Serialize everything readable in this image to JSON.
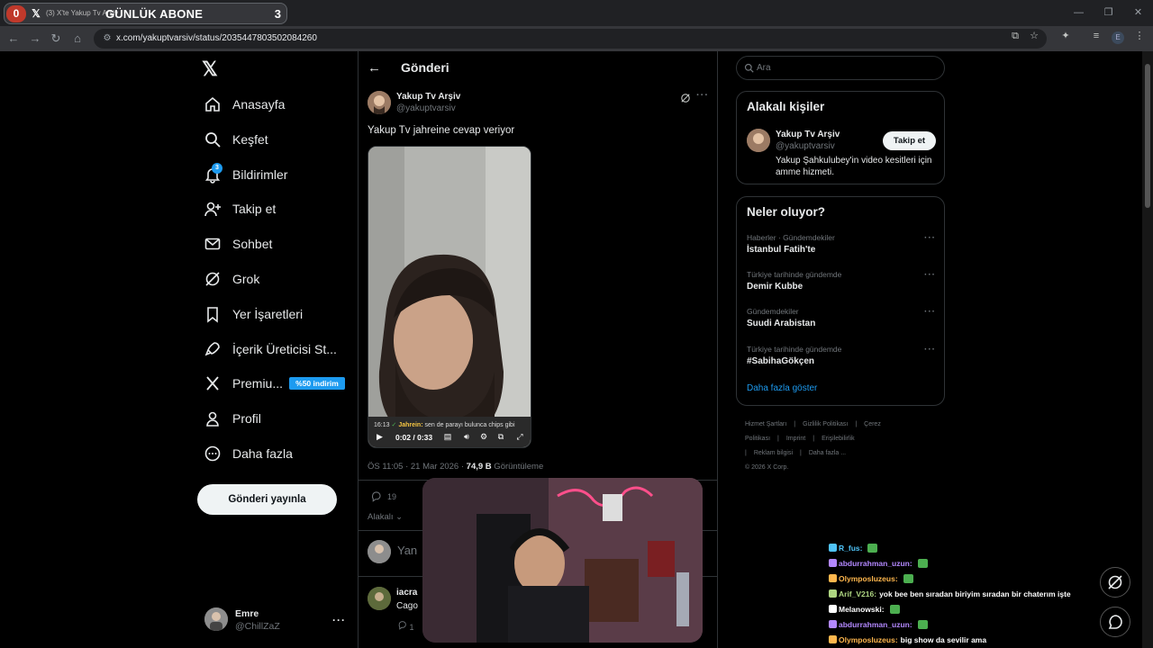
{
  "browser": {
    "tab_counter_left": "0",
    "tab_title": "(3) X'te Yakup Tv Arşiv",
    "overlay_title": "GÜNLÜK ABONE",
    "overlay_count": "3",
    "url": "x.com/yakuptvarsiv/status/2035447803502084260",
    "profile_initial": "E"
  },
  "sidebar": {
    "items": [
      {
        "label": "Anasayfa",
        "icon": "home-icon"
      },
      {
        "label": "Keşfet",
        "icon": "search-icon"
      },
      {
        "label": "Bildirimler",
        "icon": "bell-icon"
      },
      {
        "label": "Takip et",
        "icon": "person-add-icon"
      },
      {
        "label": "Sohbet",
        "icon": "mail-icon"
      },
      {
        "label": "Grok",
        "icon": "grok-icon"
      },
      {
        "label": "Yer İşaretleri",
        "icon": "bookmark-icon"
      },
      {
        "label": "İçerik Üreticisi St...",
        "icon": "rocket-icon"
      },
      {
        "label": "Premiu...",
        "icon": "x-icon"
      },
      {
        "label": "Profil",
        "icon": "person-icon"
      },
      {
        "label": "Daha fazla",
        "icon": "more-circle-icon"
      }
    ],
    "notification_badge": "3",
    "premium_badge": "%50 indirim",
    "post_button": "Gönderi yayınla",
    "account": {
      "name": "Emre",
      "handle": "@ChillZaZ"
    }
  },
  "post": {
    "header_title": "Gönderi",
    "author_name": "Yakup Tv Arşiv",
    "author_handle": "@yakuptvarsiv",
    "text": "Yakup Tv jahreine cevap veriyor",
    "video": {
      "caption_prefix": "16:13",
      "caption_user": "Jahrein:",
      "caption_text": "sen de parayı bulunca chips gibi",
      "time": "0:02 / 0:33"
    },
    "timestamp": "ÖS 11:05 · 21 Mar 2026 · ",
    "views_count": "74,9 B",
    "views_label": " Görüntüleme",
    "reply_count": "19",
    "sort_label": "Alakalı",
    "reply_placeholder": "Yan",
    "reply": {
      "name": "iacra",
      "text": "Cago",
      "count": "1"
    }
  },
  "right": {
    "search_placeholder": "Ara",
    "related": {
      "title": "Alakalı kişiler",
      "name": "Yakup Tv Arşiv",
      "handle": "@yakuptvarsiv",
      "follow": "Takip et",
      "bio": "Yakup Şahkulubey'in video kesitleri için amme hizmeti."
    },
    "trends": {
      "title": "Neler oluyor?",
      "items": [
        {
          "category": "Haberler · Gündemdekiler",
          "name": "İstanbul Fatih'te"
        },
        {
          "category": "Türkiye tarihinde gündemde",
          "name": "Demir Kubbe"
        },
        {
          "category": "Gündemdekiler",
          "name": "Suudi Arabistan"
        },
        {
          "category": "Türkiye tarihinde gündemde",
          "name": "#SabihaGökçen"
        }
      ],
      "show_more": "Daha fazla göster"
    },
    "footer": [
      "Hizmet Şartları",
      "|",
      "Gizlilik Politikası",
      "|",
      "Çerez Politikası",
      "|",
      "Imprint",
      "|",
      "Erişilebilirlik",
      "|",
      "Reklam bilgisi",
      "|",
      "Daha fazla ...",
      "© 2026 X Corp."
    ]
  },
  "chat": [
    {
      "user": "R_fus:",
      "color": "#4fc3f7",
      "text": ""
    },
    {
      "user": "abdurrahman_uzun:",
      "color": "#b388ff",
      "text": ""
    },
    {
      "user": "Olymposluzeus:",
      "color": "#ffb74d",
      "text": ""
    },
    {
      "user": "Arif_V216:",
      "color": "#aed581",
      "text": "yok bee ben sıradan biriyim sıradan bir chaterım işte"
    },
    {
      "user": "Melanowski:",
      "color": "#ffffff",
      "text": ""
    },
    {
      "user": "abdurrahman_uzun:",
      "color": "#b388ff",
      "text": ""
    },
    {
      "user": "Olymposluzeus:",
      "color": "#ffb74d",
      "text": "big show da sevilir ama"
    }
  ]
}
